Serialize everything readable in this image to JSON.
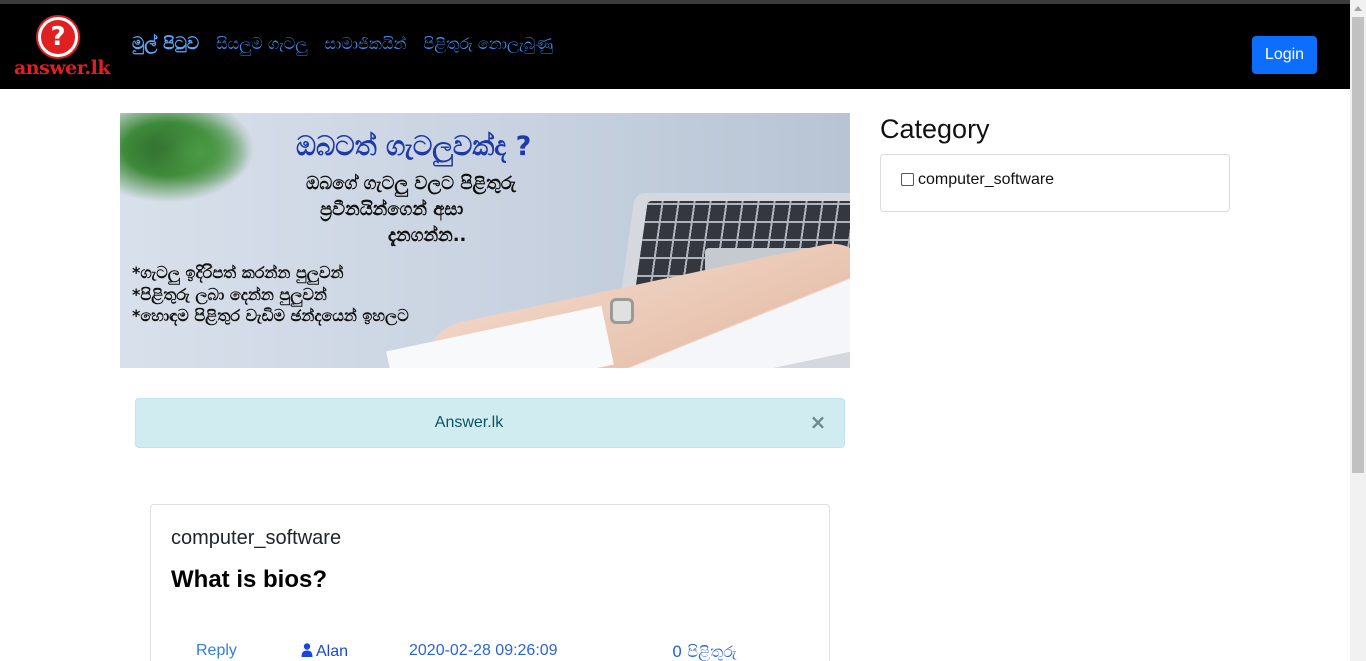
{
  "brand": {
    "logo_text": "answer.lk"
  },
  "nav": {
    "items": [
      {
        "label": "මුල් පිටුව",
        "active": true
      },
      {
        "label": "සියලුම ගැටලු",
        "active": false
      },
      {
        "label": "සාමාජිකයින්",
        "active": false
      },
      {
        "label": "පිළිතුරු නොලැබුණු",
        "active": false
      }
    ],
    "login_label": "Login"
  },
  "banner": {
    "title": "ඔබටත් ගැටලුවක්ද ?",
    "line1": "ඔබගේ ගැටලු වලට පිළිතුරු",
    "line2": "ප්‍රවීනයින්ගෙන් අසා",
    "line3": "දැනගන්න..",
    "points": [
      "*ගැටලු ඉදිරිපත් කරන්න පුලුවන්",
      "*පිළිතුරු ලබා දෙන්න පුලුවන්",
      "*හොඳම පිළිතුර වැඩිම ඡන්දයෙන් ඉහලට"
    ]
  },
  "alert": {
    "message": "Answer.lk",
    "close": "×"
  },
  "question": {
    "category": "computer_software",
    "title": "What is bios?",
    "reply_label": "Reply",
    "author": "Alan",
    "datetime": "2020-02-28 09:26:09",
    "answers": "0 පිළිතුරු"
  },
  "sidebar": {
    "heading": "Category",
    "categories": [
      {
        "label": "computer_software",
        "checked": false
      }
    ]
  },
  "colors": {
    "navbar": "#000000",
    "link": "#3b8cf0",
    "primary": "#0d6efd",
    "alert_bg": "#d1ecf1",
    "alert_text": "#0c5460"
  }
}
